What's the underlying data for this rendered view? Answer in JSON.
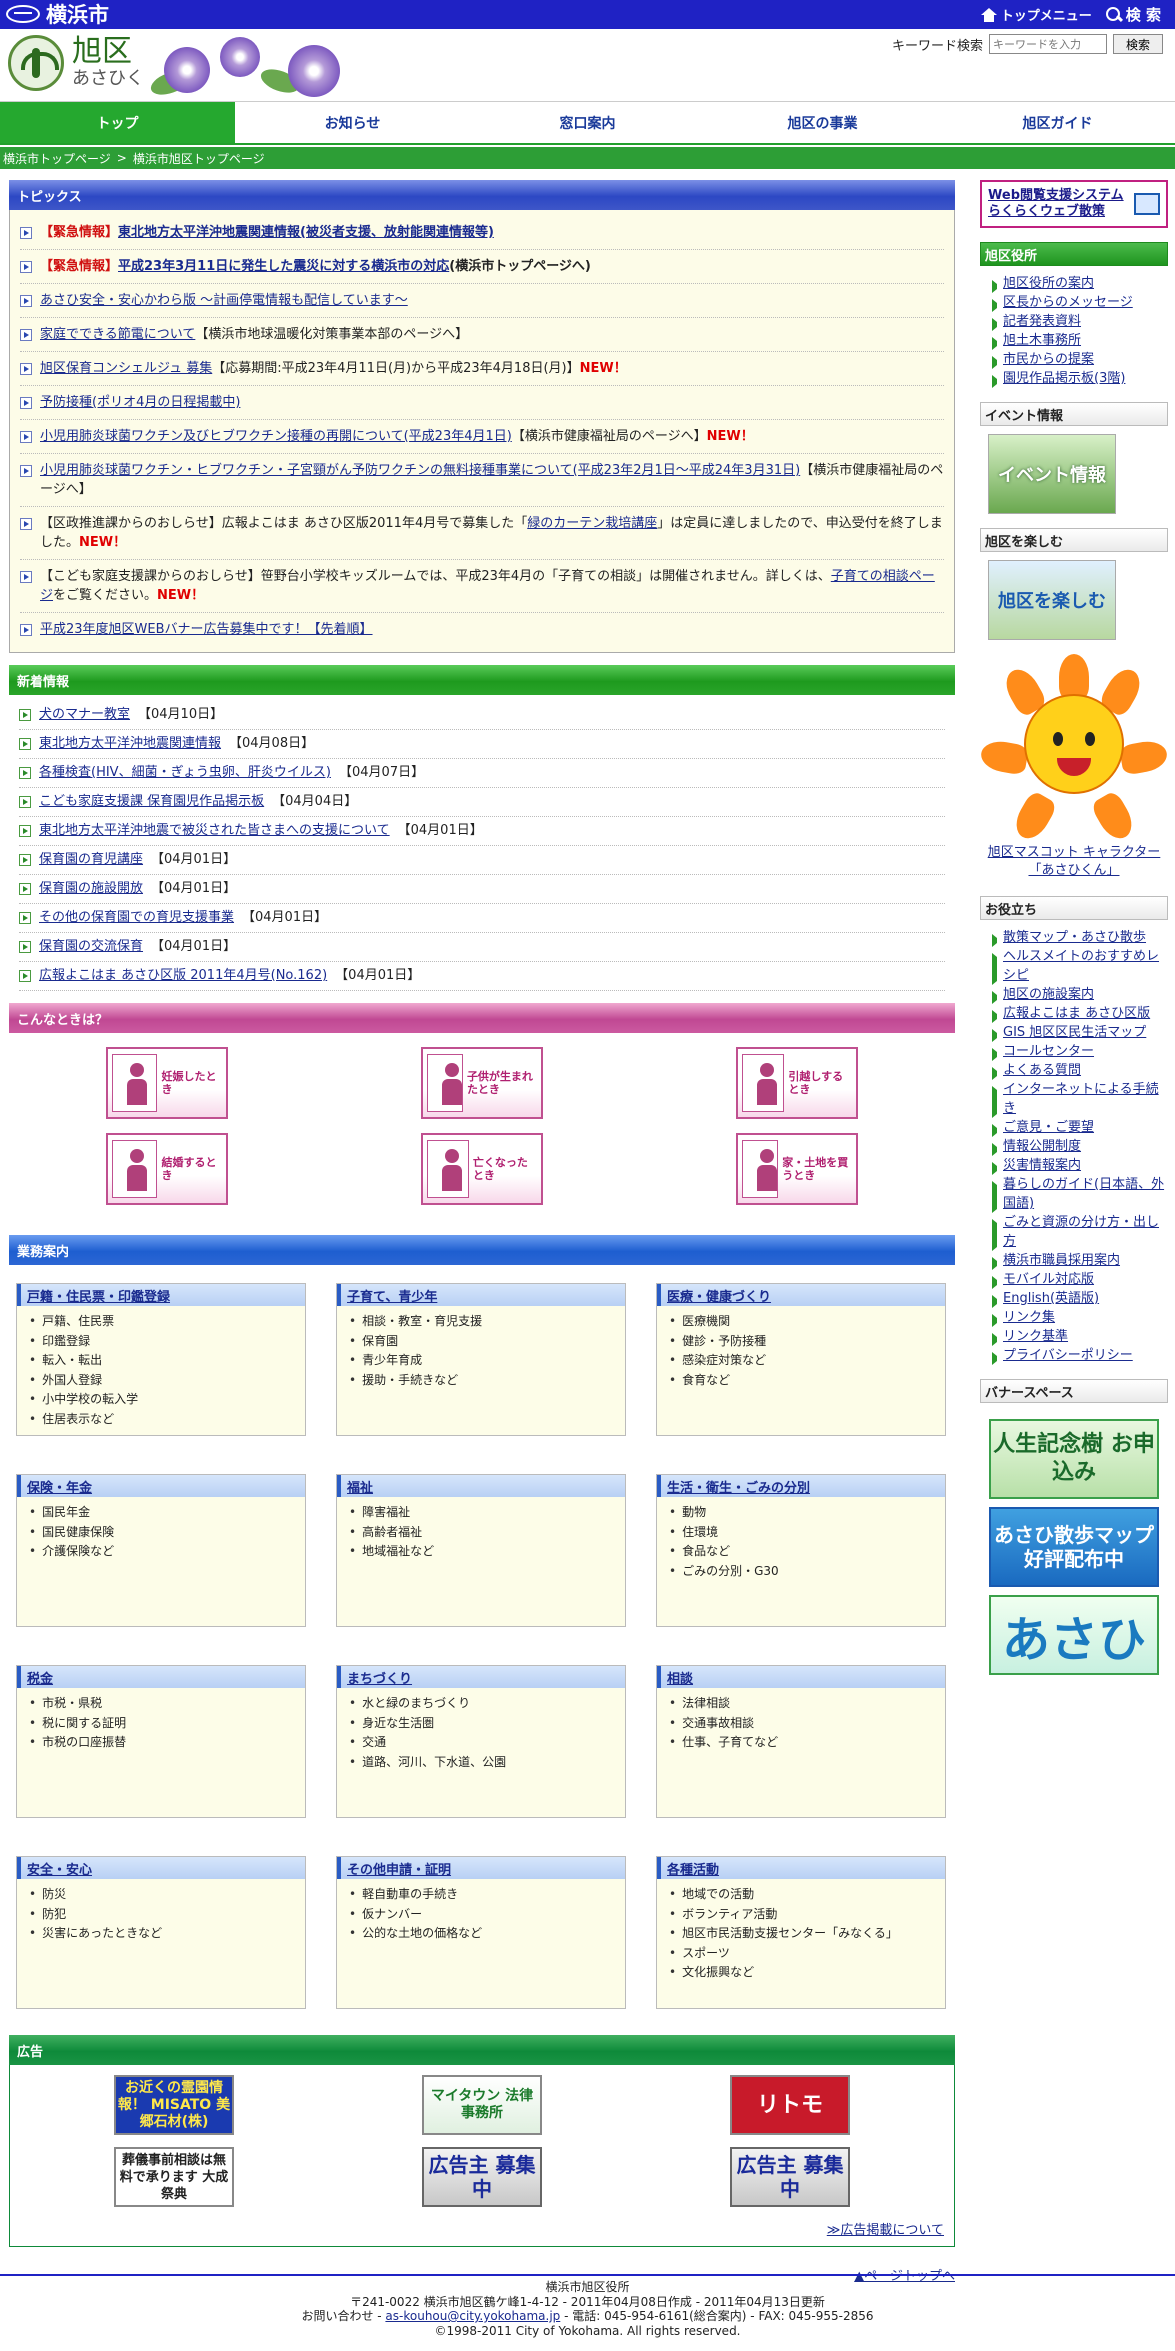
{
  "topbar": {
    "city": "横浜市",
    "links": [
      "トップメニュー",
      "検 索"
    ]
  },
  "header": {
    "ward": "旭区",
    "kana": "あさひく",
    "search_label": "キーワード検索",
    "search_placeholder": "キーワードを入力",
    "search_button": "検索"
  },
  "nav": [
    "トップ",
    "お知らせ",
    "窓口案内",
    "旭区の事業",
    "旭区ガイド"
  ],
  "breadcrumb": [
    "横浜市トップページ",
    ">",
    "横浜市旭区トップページ"
  ],
  "topics": {
    "title": "トピックス",
    "items": [
      {
        "prefix": "【緊急情報】",
        "link": "東北地方太平洋沖地震関連情報(被災者支援、放射能関連情報等)",
        "suffix": "",
        "new": ""
      },
      {
        "prefix": "【緊急情報】",
        "link": "平成23年3月11日に発生した震災に対する横浜市の対応",
        "suffix": "(横浜市トップページへ)",
        "new": ""
      },
      {
        "prefix": "",
        "link": "あさひ安全・安心かわら版 ～計画停電情報も配信しています～",
        "suffix": "",
        "new": ""
      },
      {
        "prefix": "",
        "link": "家庭でできる節電について",
        "suffix": "【横浜市地球温暖化対策事業本部のページへ】",
        "new": ""
      },
      {
        "prefix": "",
        "link": "旭区保育コンシェルジュ 募集",
        "suffix": "【応募期間:平成23年4月11日(月)から平成23年4月18日(月)】",
        "new": "NEW！"
      },
      {
        "prefix": "",
        "link": "予防接種(ポリオ4月の日程掲載中)",
        "suffix": "",
        "new": ""
      },
      {
        "prefix": "",
        "link": "小児用肺炎球菌ワクチン及びヒブワクチン接種の再開について(平成23年4月1日)",
        "suffix": "【横浜市健康福祉局のページへ】",
        "new": "NEW！"
      },
      {
        "prefix": "",
        "link": "小児用肺炎球菌ワクチン・ヒブワクチン・子宮頸がん予防ワクチンの無料接種事業について(平成23年2月1日～平成24年3月31日)",
        "suffix": "【横浜市健康福祉局のページへ】",
        "new": ""
      },
      {
        "prefix": "",
        "pre": "【区政推進課からのおしらせ】広報よこはま あさひ区版2011年4月号で募集した「",
        "link": "緑のカーテン栽培講座",
        "suffix": "」は定員に達しましたので、申込受付を終了しました。",
        "new": "NEW！"
      },
      {
        "prefix": "",
        "pre": "【こども家庭支援課からのおしらせ】笹野台小学校キッズルームでは、平成23年4月の「子育ての相談」は開催されません。詳しくは、",
        "link": "子育ての相談ページ",
        "suffix": "をご覧ください。",
        "new": "NEW！"
      },
      {
        "prefix": "",
        "link": "平成23年度旭区WEBバナー広告募集中です！【先着順】",
        "suffix": "",
        "new": ""
      }
    ]
  },
  "news": {
    "title": "新着情報",
    "items": [
      {
        "link": "犬のマナー教室",
        "date": "【04月10日】"
      },
      {
        "link": "東北地方太平洋沖地震関連情報",
        "date": "【04月08日】"
      },
      {
        "link": "各種検査(HIV、細菌・ぎょう虫卵、肝炎ウイルス)",
        "date": "【04月07日】"
      },
      {
        "link": "こども家庭支援課 保育園児作品掲示板",
        "date": "【04月04日】"
      },
      {
        "link": "東北地方太平洋沖地震で被災された皆さまへの支援について",
        "date": "【04月01日】"
      },
      {
        "link": "保育園の育児講座",
        "date": "【04月01日】"
      },
      {
        "link": "保育園の施設開放",
        "date": "【04月01日】"
      },
      {
        "link": "その他の保育園での育児支援事業",
        "date": "【04月01日】"
      },
      {
        "link": "保育園の交流保育",
        "date": "【04月01日】"
      },
      {
        "link": "広報よこはま あさひ区版 2011年4月号(No.162)",
        "date": "【04月01日】"
      }
    ]
  },
  "konna": {
    "title": "こんなときは？",
    "items": [
      "妊娠したとき",
      "子供が生まれたとき",
      "引越しするとき",
      "結婚するとき",
      "亡くなったとき",
      "家・土地を買うとき"
    ]
  },
  "gyomu": {
    "title": "業務案内",
    "cards": [
      {
        "title": "戸籍・住民票・印鑑登録",
        "items": [
          "戸籍、住民票",
          "印鑑登録",
          "転入・転出",
          "外国人登録",
          "小中学校の転入学",
          "住居表示など"
        ]
      },
      {
        "title": "子育て、青少年",
        "items": [
          "相談・教室・育児支援",
          "保育園",
          "青少年育成",
          "援助・手続きなど"
        ]
      },
      {
        "title": "医療・健康づくり",
        "items": [
          "医療機関",
          "健診・予防接種",
          "感染症対策など",
          "食育など"
        ]
      },
      {
        "title": "保険・年金",
        "items": [
          "国民年金",
          "国民健康保険",
          "介護保険など"
        ]
      },
      {
        "title": "福祉",
        "items": [
          "障害福祉",
          "高齢者福祉",
          "地域福祉など"
        ]
      },
      {
        "title": "生活・衛生・ごみの分別",
        "items": [
          "動物",
          "住環境",
          "食品など",
          "ごみの分別・G30"
        ]
      },
      {
        "title": "税金",
        "items": [
          "市税・県税",
          "税に関する証明",
          "市税の口座振替"
        ]
      },
      {
        "title": "まちづくり",
        "items": [
          "水と緑のまちづくり",
          "身近な生活圏",
          "交通",
          "道路、河川、下水道、公園"
        ]
      },
      {
        "title": "相談",
        "items": [
          "法律相談",
          "交通事故相談",
          "仕事、子育てなど"
        ]
      },
      {
        "title": "安全・安心",
        "items": [
          "防災",
          "防犯",
          "災害にあったときなど"
        ]
      },
      {
        "title": "その他申請・証明",
        "items": [
          "軽自動車の手続き",
          "仮ナンバー",
          "公的な土地の価格など"
        ]
      },
      {
        "title": "各種活動",
        "items": [
          "地域での活動",
          "ボランティア活動",
          "旭区市民活動支援センター「みなくる」",
          "スポーツ",
          "文化振興など"
        ]
      }
    ]
  },
  "ads": {
    "title": "広告",
    "items": [
      {
        "text": "お近くの霊園情報！ MISATO 美郷石材(株)"
      },
      {
        "text": "マイタウン 法律事務所"
      },
      {
        "text": "リトモ"
      },
      {
        "text": "葬儀事前相談は無料で承ります 大成祭典"
      },
      {
        "text": "広告主 募集中"
      },
      {
        "text": "広告主 募集中"
      }
    ],
    "link": "≫広告掲載について"
  },
  "pagetop": "▲ページトップへ",
  "side": {
    "banner": [
      "Web閲覧支援システム",
      "らくらくウェブ散策"
    ],
    "office": {
      "title": "旭区役所",
      "items": [
        "旭区役所の案内",
        "区長からのメッセージ",
        "記者発表資料",
        "旭土木事務所",
        "市民からの提案",
        "園児作品掲示板(3階)"
      ]
    },
    "event": {
      "title": "イベント情報",
      "img": "イベント情報"
    },
    "enjoy": {
      "title": "旭区を楽しむ",
      "img": "旭区を楽しむ"
    },
    "mascot": [
      "旭区マスコット キャラクター",
      "「あさひくん」"
    ],
    "useful": {
      "title": "お役立ち",
      "items": [
        "散策マップ・あさひ散歩",
        "ヘルスメイトのおすすめレシピ",
        "旭区の施設案内",
        "広報よこはま あさひ区版",
        "GIS 旭区区民生活マップ",
        "コールセンター",
        "よくある質問",
        "インターネットによる手続き",
        "ご意見・ご要望",
        "情報公開制度",
        "災害情報案内",
        "暮らしのガイド(日本語、外国語)",
        "ごみと資源の分け方・出し方",
        "横浜市職員採用案内",
        "モバイル対応版",
        "English(英語版)",
        "リンク集",
        "リンク基準",
        "プライバシーポリシー"
      ]
    },
    "banner_space": {
      "title": "バナースペース",
      "ads": [
        "人生記念樹 お申込み",
        "あさひ散歩マップ 好評配布中",
        "あさひ"
      ]
    }
  },
  "footer": {
    "office": "横浜市旭区役所",
    "address": "〒241-0022 横浜市旭区鶴ケ峰1-4-12 - 2011年04月08日作成 - 2011年04月13日更新",
    "contact_pre": "お問い合わせ - ",
    "email": "as-kouhou@city.yokohama.jp",
    "contact_post": " - 電話: 045-954-6161(総合案内) - FAX: 045-955-2856",
    "copyright": "©1998-2011 City of Yokohama. All rights reserved."
  }
}
